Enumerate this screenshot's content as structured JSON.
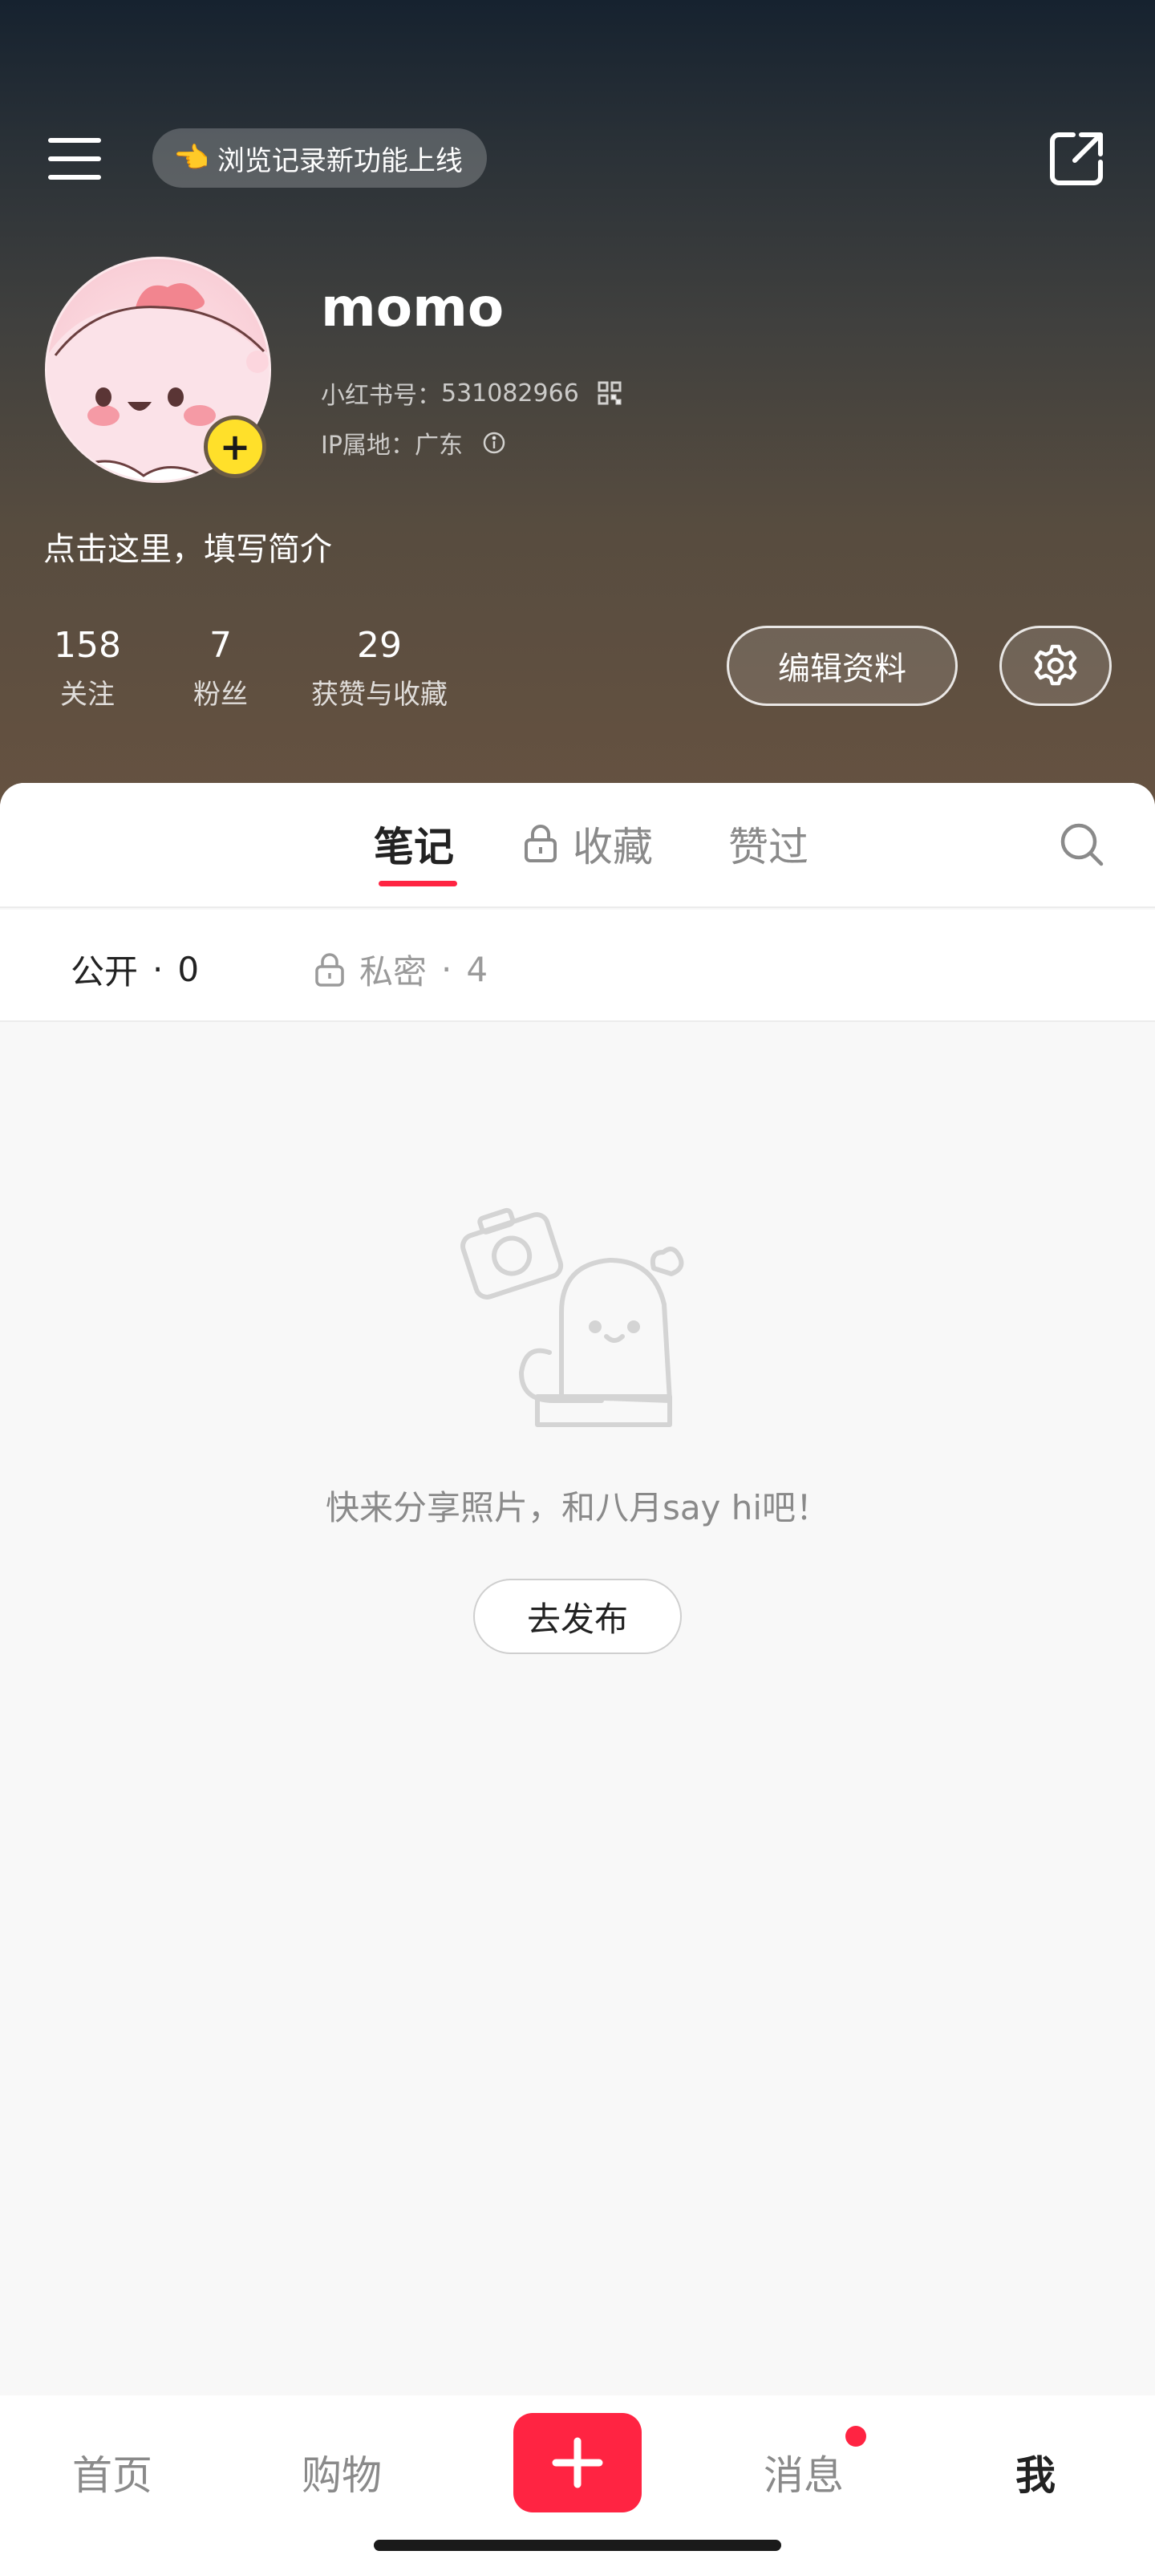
{
  "topbar": {
    "notice_emoji": "👈",
    "notice_text": "浏览记录新功能上线"
  },
  "profile": {
    "username": "momo",
    "id_label": "小红书号：",
    "id_value": "531082966",
    "ip_label": "IP属地：",
    "ip_value": "广东",
    "bio": "点击这里，填写简介",
    "add_symbol": "+"
  },
  "stats": [
    {
      "value": "158",
      "label": "关注"
    },
    {
      "value": "7",
      "label": "粉丝"
    },
    {
      "value": "29",
      "label": "获赞与收藏"
    }
  ],
  "actions": {
    "edit_label": "编辑资料"
  },
  "tabs": [
    {
      "label": "笔记",
      "active": true
    },
    {
      "label": "收藏",
      "locked": true
    },
    {
      "label": "赞过"
    }
  ],
  "subtabs": {
    "public_label": "公开",
    "public_count": "0",
    "private_label": "私密",
    "private_count": "4",
    "separator": "·"
  },
  "empty_state": {
    "message": "快来分享照片，和八月say hi吧！",
    "button_label": "去发布"
  },
  "bottom_nav": [
    {
      "label": "首页"
    },
    {
      "label": "购物"
    },
    {
      "label": "消息",
      "has_badge": true
    },
    {
      "label": "我",
      "active": true
    }
  ],
  "colors": {
    "accent": "#ff2442",
    "plus_badge": "#ffe02a"
  }
}
